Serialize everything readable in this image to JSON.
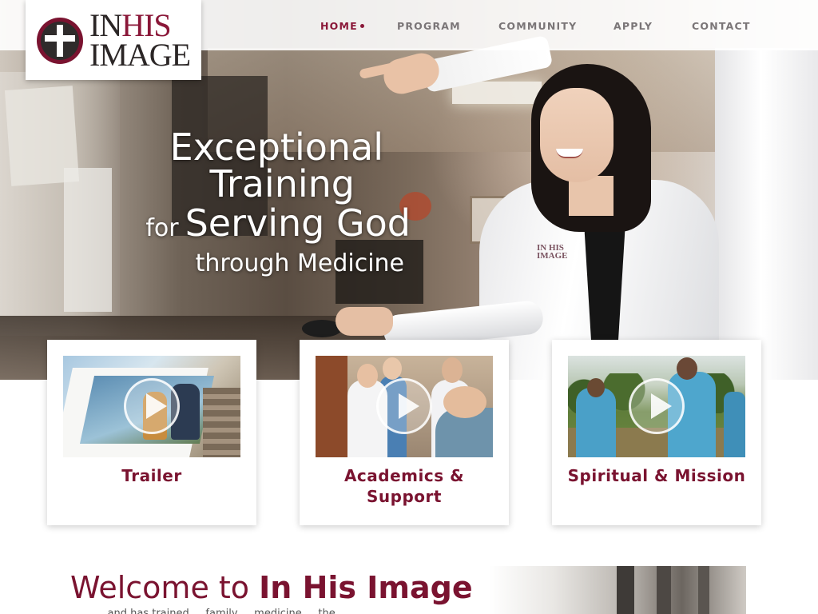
{
  "logo": {
    "line1_in": "IN",
    "line1_his": "HIS",
    "line2": "IMAGE",
    "icon": "cross-circle-icon"
  },
  "nav": {
    "items": [
      {
        "label": "HOME",
        "active": true
      },
      {
        "label": "PROGRAM",
        "active": false
      },
      {
        "label": "COMMUNITY",
        "active": false
      },
      {
        "label": "APPLY",
        "active": false
      },
      {
        "label": "CONTACT",
        "active": false
      }
    ]
  },
  "hero": {
    "line1": "Exceptional",
    "line2": "Training",
    "line3_small": "for",
    "line3": "Serving God",
    "line4": "through Medicine",
    "badge_text": "IN HIS IMAGE"
  },
  "videos": [
    {
      "title": "Trailer",
      "icon": "play-icon"
    },
    {
      "title_line1": "Academics &",
      "title_line2": "Support",
      "icon": "play-icon"
    },
    {
      "title": "Spiritual & Mission",
      "icon": "play-icon"
    }
  ],
  "welcome": {
    "prefix": "Welcome to",
    "brand": "In His Image",
    "intro": "... and has trained ... family ... medicine ... the ..."
  },
  "colors": {
    "brand": "#7a1330",
    "nav_inactive": "#7a7577",
    "white": "#ffffff"
  }
}
